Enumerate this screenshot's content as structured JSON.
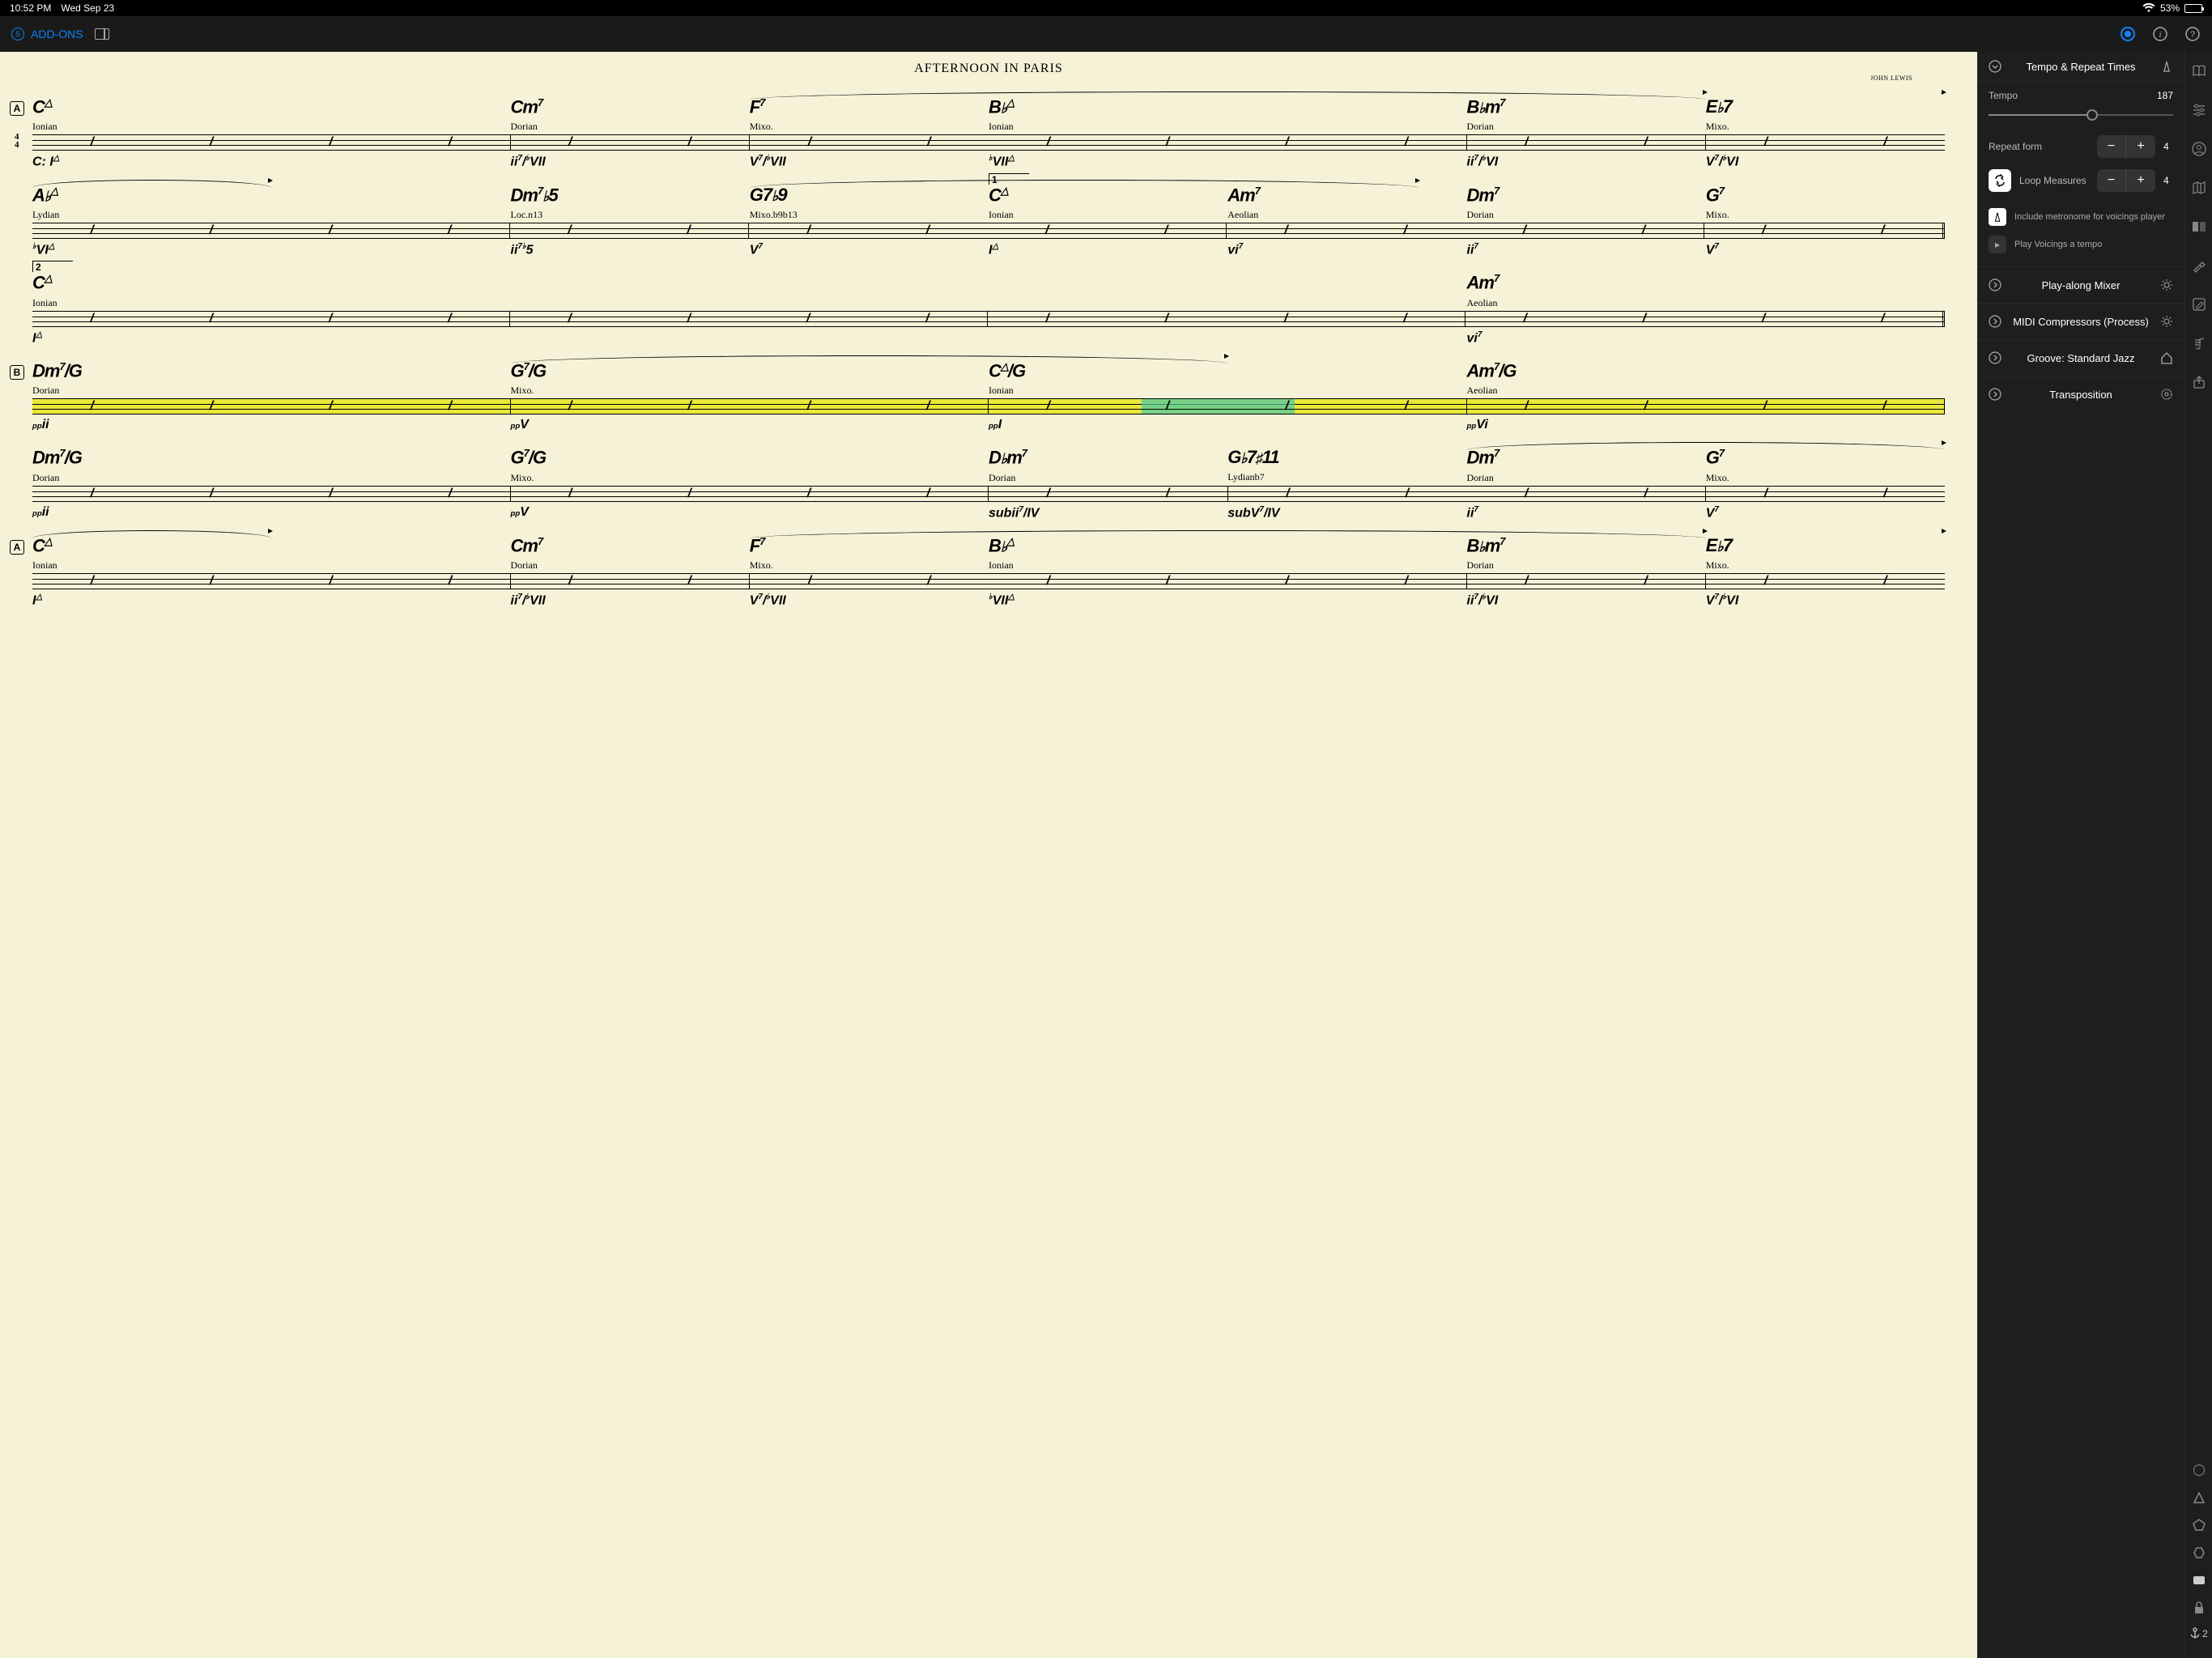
{
  "status": {
    "time": "10:52 PM",
    "date": "Wed Sep 23",
    "battery": "53%",
    "wifi": true
  },
  "toolbar": {
    "addons_label": "ADD-ONS"
  },
  "song": {
    "title": "AFTERNOON IN PARIS",
    "composer": "JOHN LEWIS"
  },
  "systems": [
    {
      "section": "A",
      "timesig": "4/4",
      "arcs": [
        {
          "from": 2,
          "span": 2
        },
        {
          "from": 6,
          "span": 2.5
        }
      ],
      "measures": [
        {
          "chord": "C△",
          "scale": "Ionian",
          "analysis": "C: I△",
          "beats": 4
        },
        {
          "chord": "Cm7",
          "scale": "Dorian",
          "analysis": "ii7/♭VII",
          "beats": 2
        },
        {
          "chord": "F7",
          "scale": "Mixo.",
          "analysis": "V7/♭VII",
          "beats": 2,
          "noBar": true
        },
        {
          "chord": "B♭△",
          "scale": "Ionian",
          "analysis": "♭VII△",
          "beats": 4
        },
        {
          "chord": "B♭m7",
          "scale": "Dorian",
          "analysis": "ii7/♭VI",
          "beats": 2
        },
        {
          "chord": "E♭7",
          "scale": "Mixo.",
          "analysis": "V7/♭VI",
          "beats": 2,
          "noBar": true
        }
      ]
    },
    {
      "arcs": [
        {
          "from": 0,
          "span": 0.5
        },
        {
          "from": 2,
          "span": 1.4
        }
      ],
      "ending": {
        "num": "1",
        "at": 3
      },
      "measures": [
        {
          "chord": "A♭△",
          "scale": "Lydian",
          "analysis": "♭VI△",
          "beats": 4
        },
        {
          "chord": "Dm7♭5",
          "scale": "Loc.n13",
          "analysis": "ii7♭5",
          "beats": 2
        },
        {
          "chord": "G7♭9",
          "scale": "Mixo.b9b13",
          "analysis": "V7",
          "beats": 2,
          "noBar": true
        },
        {
          "chord": "C△",
          "scale": "Ionian",
          "analysis": "I△",
          "beats": 2
        },
        {
          "chord": "Am7",
          "scale": "Aeolian",
          "analysis": "vi7",
          "beats": 2,
          "noBar": true
        },
        {
          "chord": "Dm7",
          "scale": "Dorian",
          "analysis": "ii7",
          "beats": 2
        },
        {
          "chord": "G7",
          "scale": "Mixo.",
          "analysis": "V7",
          "beats": 2,
          "noBar": true,
          "endRepeat": true
        }
      ]
    },
    {
      "ending": {
        "num": "2",
        "at": 0
      },
      "measures": [
        {
          "chord": "C△",
          "scale": "Ionian",
          "analysis": "I△",
          "beats": 4
        },
        {
          "chord": "",
          "scale": "",
          "analysis": "",
          "beats": 4
        },
        {
          "chord": "",
          "scale": "",
          "analysis": "",
          "beats": 4
        },
        {
          "chord": "Am7",
          "scale": "Aeolian",
          "analysis": "vi7",
          "beats": 4,
          "endRepeat": true
        }
      ]
    },
    {
      "section": "B",
      "highlight": true,
      "playhead": 0.58,
      "arcs": [
        {
          "from": 1,
          "span": 1.5
        }
      ],
      "measures": [
        {
          "chord": "Dm7/G",
          "scale": "Dorian",
          "analysis": "ppii",
          "beats": 4
        },
        {
          "chord": "G7/G",
          "scale": "Mixo.",
          "analysis": "ppV",
          "beats": 4
        },
        {
          "chord": "C△/G",
          "scale": "Ionian",
          "analysis": "ppI",
          "beats": 4
        },
        {
          "chord": "Am7/G",
          "scale": "Aeolian",
          "analysis": "ppVi",
          "beats": 4
        }
      ]
    },
    {
      "arcs": [
        {
          "from": 4,
          "span": 2.5
        }
      ],
      "measures": [
        {
          "chord": "Dm7/G",
          "scale": "Dorian",
          "analysis": "ppii",
          "beats": 4
        },
        {
          "chord": "G7/G",
          "scale": "Mixo.",
          "analysis": "ppV",
          "beats": 4
        },
        {
          "chord": "D♭m7",
          "scale": "Dorian",
          "analysis": "subii7/IV",
          "beats": 2
        },
        {
          "chord": "G♭7♯11",
          "scale": "Lydianb7",
          "analysis": "subV7/IV",
          "beats": 2,
          "noBar": true
        },
        {
          "chord": "Dm7",
          "scale": "Dorian",
          "analysis": "ii7",
          "beats": 2
        },
        {
          "chord": "G7",
          "scale": "Mixo.",
          "analysis": "V7",
          "beats": 2,
          "noBar": true
        }
      ]
    },
    {
      "section": "A",
      "arcs": [
        {
          "from": 0,
          "span": 0.5
        },
        {
          "from": 2,
          "span": 2
        },
        {
          "from": 6,
          "span": 2.5
        }
      ],
      "measures": [
        {
          "chord": "C△",
          "scale": "Ionian",
          "analysis": "I△",
          "beats": 4
        },
        {
          "chord": "Cm7",
          "scale": "Dorian",
          "analysis": "ii7/♭VII",
          "beats": 2
        },
        {
          "chord": "F7",
          "scale": "Mixo.",
          "analysis": "V7/♭VII",
          "beats": 2,
          "noBar": true
        },
        {
          "chord": "B♭△",
          "scale": "Ionian",
          "analysis": "♭VII△",
          "beats": 4
        },
        {
          "chord": "B♭m7",
          "scale": "Dorian",
          "analysis": "ii7/♭VI",
          "beats": 2
        },
        {
          "chord": "E♭7",
          "scale": "Mixo.",
          "analysis": "V7/♭VI",
          "beats": 2,
          "noBar": true
        }
      ]
    }
  ],
  "panel": {
    "header": "Tempo & Repeat Times",
    "tempo_label": "Tempo",
    "tempo_value": "187",
    "tempo_pct": 56,
    "repeat_label": "Repeat form",
    "repeat_value": "4",
    "loop_label": "Loop Measures",
    "loop_value": "4",
    "metronome_label": "Include metronome for voicings player",
    "play_voicings_label": "Play Voicings a tempo",
    "sections": [
      {
        "label": "Play-along Mixer",
        "icon": "sun"
      },
      {
        "label": "MIDI Compressors (Process)",
        "icon": "sun"
      },
      {
        "label": "Groove: Standard Jazz",
        "icon": "home"
      },
      {
        "label": "Transposition",
        "icon": "gear"
      }
    ]
  },
  "rail": {
    "anchor_count": "2"
  }
}
